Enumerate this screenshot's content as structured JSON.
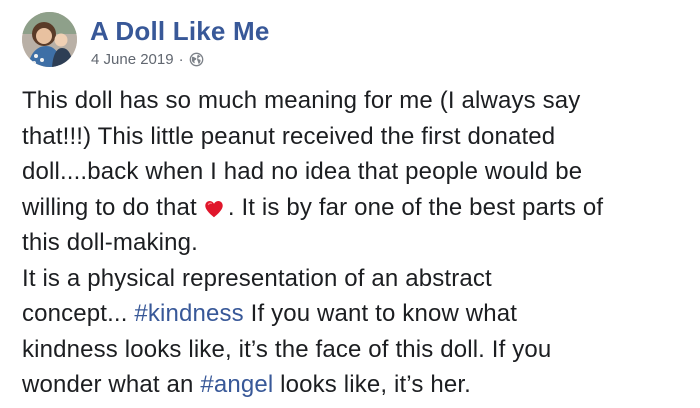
{
  "post": {
    "author": "A Doll Like Me",
    "date": "4 June 2019",
    "separator": "·",
    "privacy_icon": "globe-icon",
    "lines": [
      [
        "This doll has so much meaning for me (I always say"
      ],
      [
        "that!!!) This little peanut received the first donated"
      ],
      [
        "doll....back when I had no idea that people would be"
      ],
      [
        "willing to do that",
        ". It is by far one of the best parts of"
      ],
      [
        "this doll-making."
      ],
      [
        "It is a physical representation of an abstract"
      ],
      [
        "concept... ",
        "#kindness",
        " If you want to know what"
      ],
      [
        "kindness looks like, it’s the face of this doll. If you"
      ],
      [
        "wonder what an ",
        "#angel",
        " looks like, it’s her."
      ]
    ],
    "emoji_icon": "red-heart-icon",
    "colors": {
      "link": "#385898",
      "text": "#1c1e21",
      "meta": "#616770",
      "heart": "#e0162b"
    }
  }
}
